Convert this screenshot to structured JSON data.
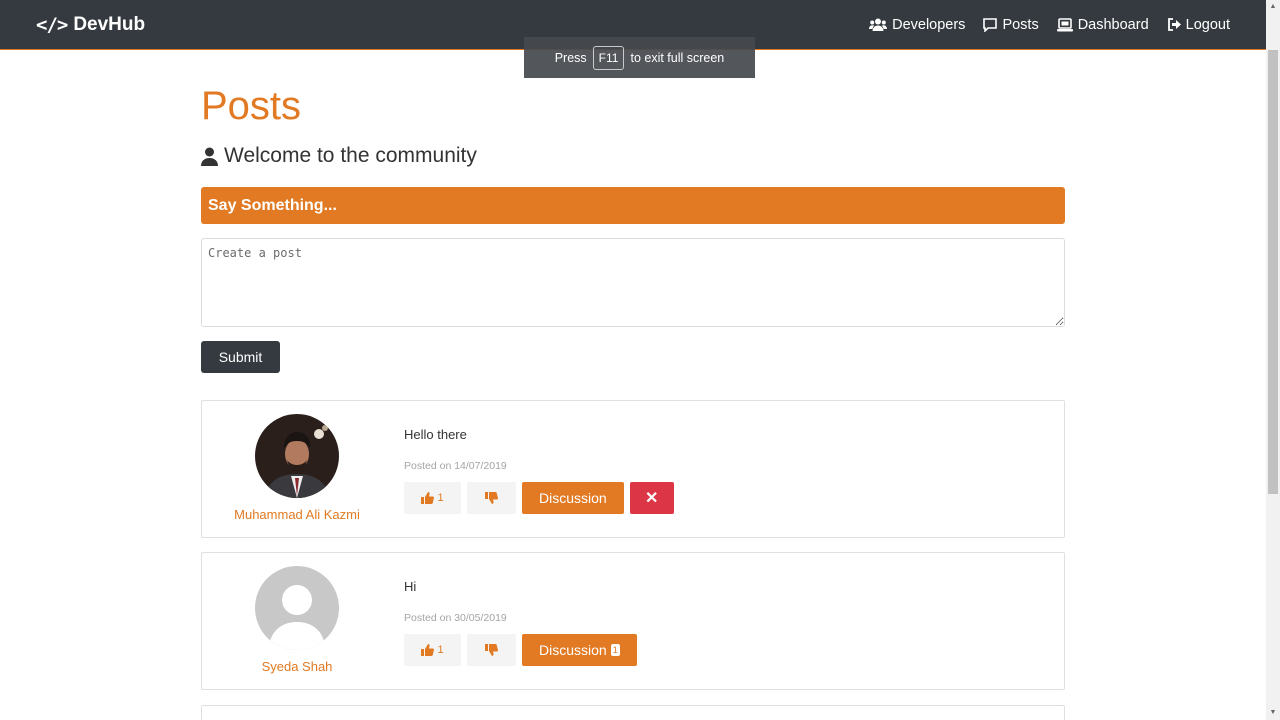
{
  "navbar": {
    "brand_icon": "</>",
    "brand": "DevHub",
    "links": [
      {
        "label": "Developers",
        "icon": "users-icon"
      },
      {
        "label": "Posts",
        "icon": "comment-icon"
      },
      {
        "label": "Dashboard",
        "icon": "laptop-icon"
      },
      {
        "label": "Logout",
        "icon": "sign-out-icon"
      }
    ]
  },
  "fullscreen_toast": {
    "before": "Press",
    "key": "F11",
    "after": "to exit full screen"
  },
  "main": {
    "title": "Posts",
    "lead": "Welcome to the community",
    "say_something": "Say Something...",
    "textarea_placeholder": "Create a post",
    "submit_label": "Submit"
  },
  "posts": [
    {
      "author": "Muhammad Ali Kazmi",
      "text": "Hello there",
      "date": "Posted on 14/07/2019",
      "likes": "1",
      "discussion_label": "Discussion",
      "comments": "",
      "delete_label": "✕"
    },
    {
      "author": "Syeda Shah",
      "text": "Hi",
      "date": "Posted on 30/05/2019",
      "likes": "1",
      "discussion_label": "Discussion",
      "comments": "1"
    }
  ],
  "colors": {
    "accent": "#e17a23",
    "navbar": "#343a40",
    "danger": "#dc3545"
  }
}
